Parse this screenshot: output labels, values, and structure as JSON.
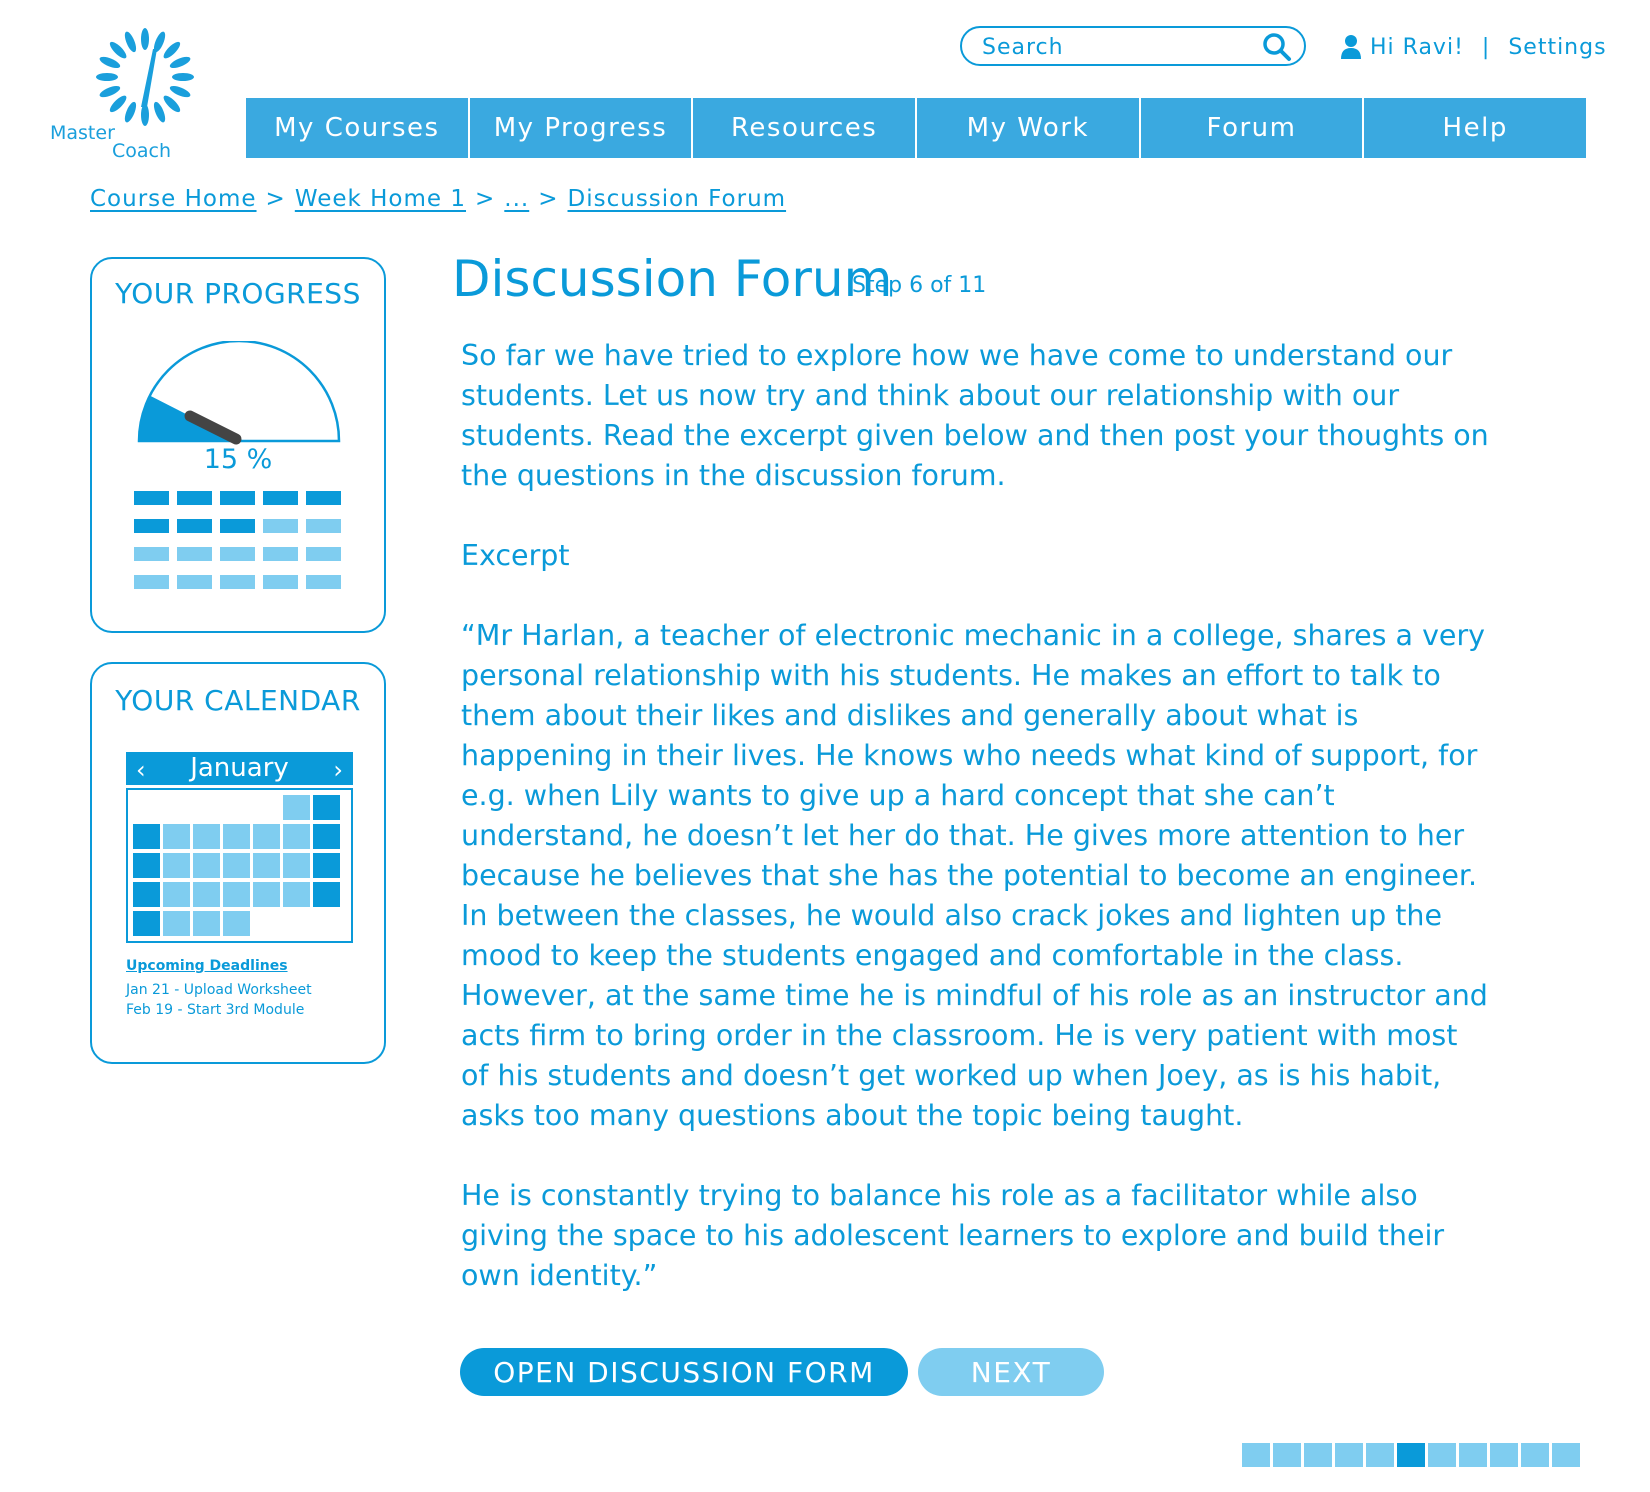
{
  "logo": {
    "line1": "Master",
    "line2": "Coach"
  },
  "search": {
    "placeholder": "Search"
  },
  "user": {
    "greeting": "Hi Ravi!",
    "separator": "|",
    "settings": "Settings"
  },
  "nav": [
    "My Courses",
    "My Progress",
    "Resources",
    "My Work",
    "Forum",
    "Help"
  ],
  "breadcrumb": {
    "items": [
      "Course Home",
      "Week Home 1",
      "...",
      "Discussion Forum"
    ],
    "separator": ">"
  },
  "progress": {
    "title": "YOUR PROGRESS",
    "percent_label": "15 %",
    "percent_value": 15,
    "blocks_completed": 8,
    "blocks_total": 20
  },
  "calendar": {
    "title": "YOUR CALENDAR",
    "month": "January",
    "prev": "‹",
    "next": "›",
    "deadlines_title": "Upcoming Deadlines",
    "deadlines": [
      "Jan 21 - Upload Worksheet",
      "Feb 19 - Start 3rd Module"
    ]
  },
  "main": {
    "title": "Discussion Forum",
    "step": "Step 6 of 11",
    "paragraphs": [
      "So far we have tried to explore how we have come to understand our students. Let us now try and think about our relationship with our students. Read the excerpt given below and then post  your thoughts on the questions in the discussion forum.",
      "Excerpt",
      "“Mr Harlan, a teacher of electronic mechanic in a college, shares a very personal relationship with his students. He makes an effort to talk to them about their likes and dislikes and generally about what is happening in their lives. He knows who needs what kind of support, for e.g. when Lily wants to give up a hard concept that she can’t understand, he doesn’t let her do that. He gives more attention to her because he believes that she has the potential to become an engineer. In between the classes, he would also crack jokes and lighten up the mood to keep the students engaged and comfortable in the class. However, at the same time he is mindful of his role as an instructor and acts firm to bring order in the classroom. He is very patient with most of his students and doesn’t get worked up when Joey, as is his habit, asks too many questions about the topic being taught.",
      "He is constantly trying to balance his role as a facilitator while also giving the space to his adolescent learners to explore and build their own identity.”"
    ]
  },
  "buttons": {
    "open": "OPEN DISCUSSION FORM",
    "next": "NEXT"
  },
  "step_indicator": {
    "current": 6,
    "total": 11
  },
  "colors": {
    "primary": "#0a9ad9",
    "nav": "#3aa9e0",
    "light": "#7fcdf0",
    "gauge_needle": "#444444"
  }
}
